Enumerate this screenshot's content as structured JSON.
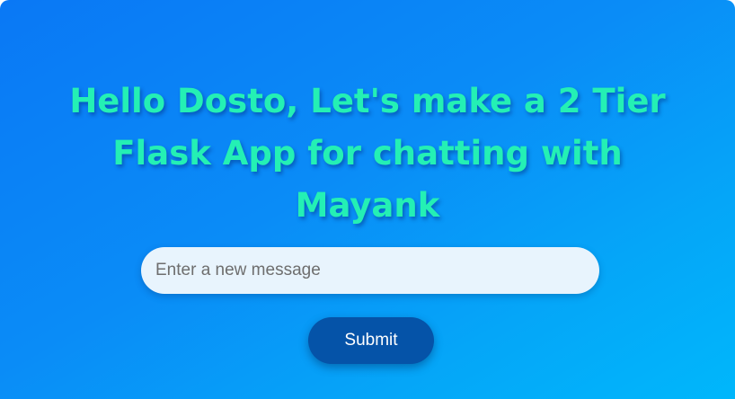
{
  "page": {
    "title_lines": [
      "Hello Dosto, Let's make a 2 Tier",
      "Flask App for chatting with",
      "Mayank"
    ]
  },
  "form": {
    "message_input": {
      "value": "",
      "placeholder": "Enter a new message"
    },
    "submit_label": "Submit"
  },
  "colors": {
    "background_start": "#0a78f5",
    "background_end": "#00b7fb",
    "heading": "#24f0b4",
    "input_background": "#e8f4fd",
    "button_background": "#0553a8",
    "button_text": "#ffffff"
  }
}
